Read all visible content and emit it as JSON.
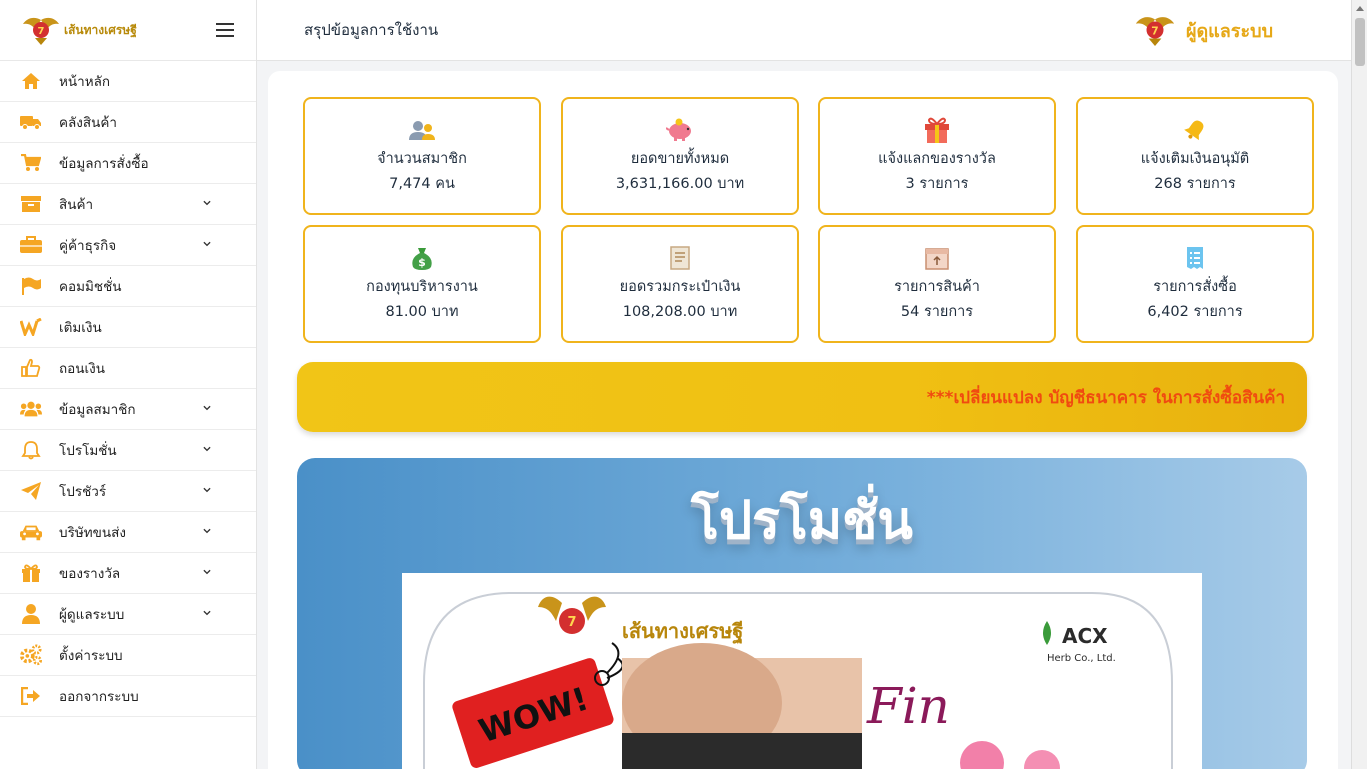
{
  "sidebar": {
    "brand_text": "เส้นทางเศรษฐี",
    "items": [
      {
        "label": "หน้าหลัก",
        "icon": "home-icon",
        "has_submenu": false
      },
      {
        "label": "คลังสินค้า",
        "icon": "truck-icon",
        "has_submenu": false
      },
      {
        "label": "ข้อมูลการสั่งซื้อ",
        "icon": "cart-icon",
        "has_submenu": false
      },
      {
        "label": "สินค้า",
        "icon": "archive-icon",
        "has_submenu": true
      },
      {
        "label": "คู่ค้าธุรกิจ",
        "icon": "briefcase-icon",
        "has_submenu": true
      },
      {
        "label": "คอมมิชชั่น",
        "icon": "flag-icon",
        "has_submenu": false
      },
      {
        "label": "เติมเงิน",
        "icon": "wallet-w-icon",
        "has_submenu": false
      },
      {
        "label": "ถอนเงิน",
        "icon": "thumbs-up-icon",
        "has_submenu": false
      },
      {
        "label": "ข้อมูลสมาชิก",
        "icon": "users-icon",
        "has_submenu": true
      },
      {
        "label": "โปรโมชั่น",
        "icon": "bell-icon",
        "has_submenu": true
      },
      {
        "label": "โปรชัวร์",
        "icon": "paper-plane-icon",
        "has_submenu": true
      },
      {
        "label": "บริษัทขนส่ง",
        "icon": "car-icon",
        "has_submenu": true
      },
      {
        "label": "ของรางวัล",
        "icon": "gift-icon",
        "has_submenu": true
      },
      {
        "label": "ผู้ดูแลระบบ",
        "icon": "user-icon",
        "has_submenu": true
      },
      {
        "label": "ตั้งค่าระบบ",
        "icon": "cogs-icon",
        "has_submenu": false
      },
      {
        "label": "ออกจากระบบ",
        "icon": "sign-out-icon",
        "has_submenu": false
      }
    ]
  },
  "header": {
    "title": "สรุปข้อมูลการใช้งาน",
    "admin_label": "ผู้ดูแลระบบ"
  },
  "stats": [
    {
      "title": "จำนวนสมาชิก",
      "value": "7,474 คน",
      "icon": "members-icon"
    },
    {
      "title": "ยอดขายทั้งหมด",
      "value": "3,631,166.00 บาท",
      "icon": "piggy-bank-icon"
    },
    {
      "title": "แจ้งแลกของรางวัล",
      "value": "3 รายการ",
      "icon": "gift-box-icon"
    },
    {
      "title": "แจ้งเติมเงินอนุมัติ",
      "value": "268 รายการ",
      "icon": "bell-approve-icon"
    },
    {
      "title": "กองทุนบริหารงาน",
      "value": "81.00 บาท",
      "icon": "money-bag-icon"
    },
    {
      "title": "ยอดรวมกระเป๋าเงิน",
      "value": "108,208.00 บาท",
      "icon": "ledger-icon"
    },
    {
      "title": "รายการสินค้า",
      "value": "54 รายการ",
      "icon": "package-icon"
    },
    {
      "title": "รายการสั่งซื้อ",
      "value": "6,402 รายการ",
      "icon": "receipt-icon"
    }
  ],
  "notice": {
    "text": "***เปลี่ยนแปลง บัญชีธนาคาร ในการสั่งซื้อสินค้า"
  },
  "promo": {
    "title": "โปรโมชั่น",
    "banner_brand": "เส้นทางเศรษฐี",
    "banner_partner": "ACX",
    "banner_partner_sub": "Herb Co., Ltd.",
    "banner_tag": "WOW!",
    "banner_product": "Fin"
  },
  "colors": {
    "accent": "#f0b41c",
    "menu_icon": "#f5a623",
    "notice_text": "#f04b10",
    "admin_text": "#e6a817"
  }
}
